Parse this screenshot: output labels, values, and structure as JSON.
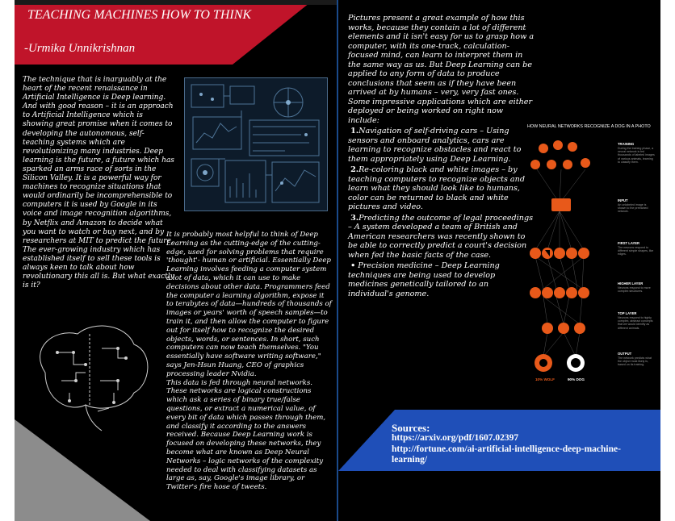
{
  "left_page": {
    "title": "TEACHING MACHINES HOW TO THINK",
    "author": "-Urmika Unnikrishnan",
    "col1": "The technique that is inarguably at the heart of the recent renaissance in Artificial Intelligence is Deep learning. And with good reason – it is an approach to Artificial Intelligence which is showing great promise when it comes to developing the autonomous, self-teaching systems which are revolutionizing many industries. Deep learning is the future, a future which has sparked an arms race of sorts in the Silicon Valley. It is a powerful way for machines to recognize situations that would ordinarily be incomprehensible to computers it is used by Google in its voice and image recognition algorithms, by Netflix and Amazon to decide what you want to watch or buy next, and by researchers at MIT to predict the future.  The ever-growing industry which has established itself to sell these tools is always keen to talk about how revolutionary this all is. But what exactly is it?",
    "col2_a": "It is probably most helpful to think of Deep Learning as the cutting-edge of the cutting-edge, used for solving problems that require 'thought'- human or artificial. Essentially Deep Learning involves feeding a computer system a lot of data, which it can use to make decisions about other data. Programmers feed the computer a learning algorithm, expose it to terabytes of data—hundreds of thousands of images or years' worth of speech samples—to train it, and then allow the computer to figure out for itself how to recognize the desired objects, words, or sentences. In short, such computers can now teach themselves. \"You essentially have software writing software,\" says Jen-Hsun Huang, CEO of graphics processing leader Nvidia.",
    "col2_b": "This data is fed through neural networks. These networks are logical constructions which ask a series of binary true/false questions, or extract a numerical value, of every bit of data which passes through them, and classify it according to the answers received. Because Deep Learning work is focused on developing these networks, they become what are known as Deep Neural Networks – logic networks of the complexity needed to deal with classifying datasets as large as, say, Google's image library, or Twitter's fire hose of tweets."
  },
  "right_page": {
    "intro": "Pictures present a great example of how this works, because they contain a lot of different elements and it isn't easy for us to grasp how a computer, with its one-track, calculation-focused mind, can learn to interpret them in the same way as us. But Deep Learning can be applied to any form of data to produce conclusions that seem as if they have been arrived at by humans – very, very fast ones. Some impressive applications which are either deployed or being worked on right now include:",
    "items": [
      {
        "num": "1.",
        "text": "Navigation of self-driving cars – Using sensors and onboard analytics, cars are learning to recognize obstacles and react to them appropriately using Deep Learning."
      },
      {
        "num": "2.",
        "text": "Re-coloring black and white images – by teaching computers to recognize objects and learn what they should look like to humans, color can be returned to black and white pictures and video."
      },
      {
        "num": "3.",
        "text": "Predicting the outcome of legal proceedings – A system developed a team of British and American researchers was recently shown to be able to correctly predict a court's decision when fed the basic facts of the case."
      },
      {
        "num": "•",
        "text": "Precision medicine – Deep Learning techniques are being used to develop medicines genetically tailored to an individual's genome."
      }
    ],
    "infographic": {
      "title": "HOW NEURAL NETWORKS RECOGNIZE A DOG IN A PHOTO",
      "layers": [
        {
          "name": "TRAINING",
          "desc": "During the training phase, a neural network is fed thousands of labeled images of various animals, learning to classify them."
        },
        {
          "name": "INPUT",
          "desc": "An unlabeled image is shown to the pretrained network."
        },
        {
          "name": "FIRST LAYER",
          "desc": "The neurons respond to different simple shapes, like edges."
        },
        {
          "name": "HIGHER LAYER",
          "desc": "Neurons respond to more complex structures."
        },
        {
          "name": "TOP LAYER",
          "desc": "Neurons respond to highly complex, abstract concepts that we would identify as different animals."
        },
        {
          "name": "OUTPUT",
          "desc": "The network predicts what the object most likely is, based on its training."
        }
      ],
      "outputs": [
        "10% WOLF",
        "90% DOG"
      ],
      "accent": "#e8591a"
    },
    "sources_head": "Sources:",
    "sources": [
      "https://arxiv.org/pdf/1607.02397",
      "http://fortune.com/ai-artificial-intelligence-deep-machine-learning/"
    ]
  },
  "colors": {
    "red": "#c0142a",
    "blue": "#1f4fb8",
    "grey": "#8c8c8c",
    "accent": "#e8591a"
  }
}
